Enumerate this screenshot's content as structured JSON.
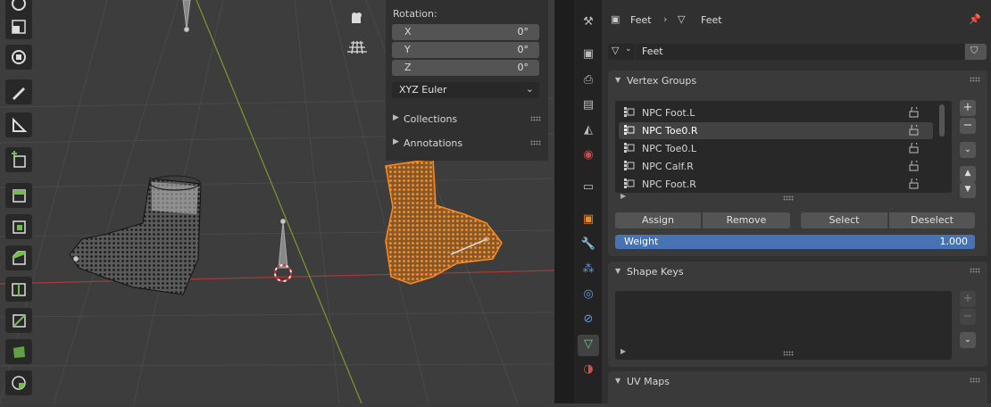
{
  "npanel": {
    "rotation_label": "Rotation:",
    "fields": [
      {
        "axis": "X",
        "value": "0°"
      },
      {
        "axis": "Y",
        "value": "0°"
      },
      {
        "axis": "Z",
        "value": "0°"
      }
    ],
    "rotation_mode": "XYZ Euler",
    "collections_label": "Collections",
    "annotations_label": "Annotations"
  },
  "props": {
    "breadcrumb": {
      "object": "Feet",
      "mesh": "Feet"
    },
    "mesh_name": "Feet",
    "vertex_groups": {
      "title": "Vertex Groups",
      "items": [
        "NPC Foot.L",
        "NPC Toe0.R",
        "NPC Toe0.L",
        "NPC Calf.R",
        "NPC Foot.R"
      ],
      "selected_index": 1
    },
    "buttons": {
      "assign": "Assign",
      "remove": "Remove",
      "select": "Select",
      "deselect": "Deselect"
    },
    "weight": {
      "label": "Weight",
      "value": "1.000"
    },
    "shape_keys_title": "Shape Keys",
    "uv_maps_title": "UV Maps"
  },
  "colors": {
    "accent": "#4772b3",
    "selected_mesh": "#ff8a1a",
    "x_axis": "#a83a3a",
    "y_axis": "#7a9a2a"
  }
}
